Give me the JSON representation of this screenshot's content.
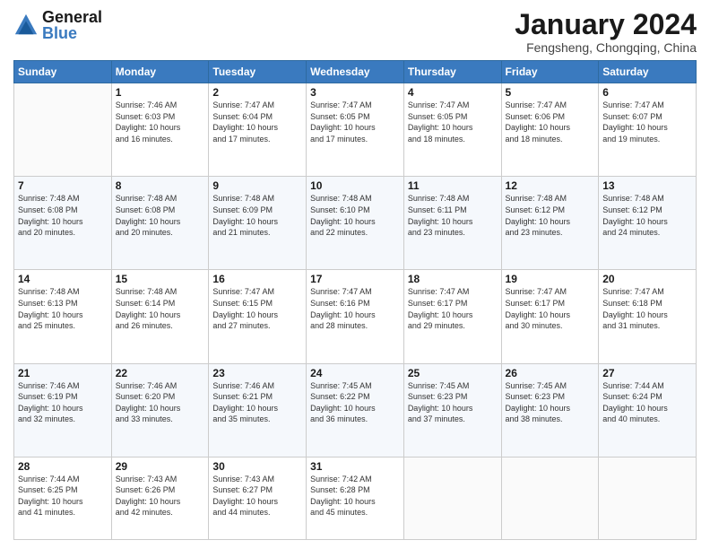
{
  "header": {
    "logo_line1": "General",
    "logo_line2": "Blue",
    "month_year": "January 2024",
    "location": "Fengsheng, Chongqing, China"
  },
  "days_of_week": [
    "Sunday",
    "Monday",
    "Tuesday",
    "Wednesday",
    "Thursday",
    "Friday",
    "Saturday"
  ],
  "weeks": [
    [
      {
        "day": "",
        "info": ""
      },
      {
        "day": "1",
        "info": "Sunrise: 7:46 AM\nSunset: 6:03 PM\nDaylight: 10 hours\nand 16 minutes."
      },
      {
        "day": "2",
        "info": "Sunrise: 7:47 AM\nSunset: 6:04 PM\nDaylight: 10 hours\nand 17 minutes."
      },
      {
        "day": "3",
        "info": "Sunrise: 7:47 AM\nSunset: 6:05 PM\nDaylight: 10 hours\nand 17 minutes."
      },
      {
        "day": "4",
        "info": "Sunrise: 7:47 AM\nSunset: 6:05 PM\nDaylight: 10 hours\nand 18 minutes."
      },
      {
        "day": "5",
        "info": "Sunrise: 7:47 AM\nSunset: 6:06 PM\nDaylight: 10 hours\nand 18 minutes."
      },
      {
        "day": "6",
        "info": "Sunrise: 7:47 AM\nSunset: 6:07 PM\nDaylight: 10 hours\nand 19 minutes."
      }
    ],
    [
      {
        "day": "7",
        "info": "Sunrise: 7:48 AM\nSunset: 6:08 PM\nDaylight: 10 hours\nand 20 minutes."
      },
      {
        "day": "8",
        "info": "Sunrise: 7:48 AM\nSunset: 6:08 PM\nDaylight: 10 hours\nand 20 minutes."
      },
      {
        "day": "9",
        "info": "Sunrise: 7:48 AM\nSunset: 6:09 PM\nDaylight: 10 hours\nand 21 minutes."
      },
      {
        "day": "10",
        "info": "Sunrise: 7:48 AM\nSunset: 6:10 PM\nDaylight: 10 hours\nand 22 minutes."
      },
      {
        "day": "11",
        "info": "Sunrise: 7:48 AM\nSunset: 6:11 PM\nDaylight: 10 hours\nand 23 minutes."
      },
      {
        "day": "12",
        "info": "Sunrise: 7:48 AM\nSunset: 6:12 PM\nDaylight: 10 hours\nand 23 minutes."
      },
      {
        "day": "13",
        "info": "Sunrise: 7:48 AM\nSunset: 6:12 PM\nDaylight: 10 hours\nand 24 minutes."
      }
    ],
    [
      {
        "day": "14",
        "info": "Sunrise: 7:48 AM\nSunset: 6:13 PM\nDaylight: 10 hours\nand 25 minutes."
      },
      {
        "day": "15",
        "info": "Sunrise: 7:48 AM\nSunset: 6:14 PM\nDaylight: 10 hours\nand 26 minutes."
      },
      {
        "day": "16",
        "info": "Sunrise: 7:47 AM\nSunset: 6:15 PM\nDaylight: 10 hours\nand 27 minutes."
      },
      {
        "day": "17",
        "info": "Sunrise: 7:47 AM\nSunset: 6:16 PM\nDaylight: 10 hours\nand 28 minutes."
      },
      {
        "day": "18",
        "info": "Sunrise: 7:47 AM\nSunset: 6:17 PM\nDaylight: 10 hours\nand 29 minutes."
      },
      {
        "day": "19",
        "info": "Sunrise: 7:47 AM\nSunset: 6:17 PM\nDaylight: 10 hours\nand 30 minutes."
      },
      {
        "day": "20",
        "info": "Sunrise: 7:47 AM\nSunset: 6:18 PM\nDaylight: 10 hours\nand 31 minutes."
      }
    ],
    [
      {
        "day": "21",
        "info": "Sunrise: 7:46 AM\nSunset: 6:19 PM\nDaylight: 10 hours\nand 32 minutes."
      },
      {
        "day": "22",
        "info": "Sunrise: 7:46 AM\nSunset: 6:20 PM\nDaylight: 10 hours\nand 33 minutes."
      },
      {
        "day": "23",
        "info": "Sunrise: 7:46 AM\nSunset: 6:21 PM\nDaylight: 10 hours\nand 35 minutes."
      },
      {
        "day": "24",
        "info": "Sunrise: 7:45 AM\nSunset: 6:22 PM\nDaylight: 10 hours\nand 36 minutes."
      },
      {
        "day": "25",
        "info": "Sunrise: 7:45 AM\nSunset: 6:23 PM\nDaylight: 10 hours\nand 37 minutes."
      },
      {
        "day": "26",
        "info": "Sunrise: 7:45 AM\nSunset: 6:23 PM\nDaylight: 10 hours\nand 38 minutes."
      },
      {
        "day": "27",
        "info": "Sunrise: 7:44 AM\nSunset: 6:24 PM\nDaylight: 10 hours\nand 40 minutes."
      }
    ],
    [
      {
        "day": "28",
        "info": "Sunrise: 7:44 AM\nSunset: 6:25 PM\nDaylight: 10 hours\nand 41 minutes."
      },
      {
        "day": "29",
        "info": "Sunrise: 7:43 AM\nSunset: 6:26 PM\nDaylight: 10 hours\nand 42 minutes."
      },
      {
        "day": "30",
        "info": "Sunrise: 7:43 AM\nSunset: 6:27 PM\nDaylight: 10 hours\nand 44 minutes."
      },
      {
        "day": "31",
        "info": "Sunrise: 7:42 AM\nSunset: 6:28 PM\nDaylight: 10 hours\nand 45 minutes."
      },
      {
        "day": "",
        "info": ""
      },
      {
        "day": "",
        "info": ""
      },
      {
        "day": "",
        "info": ""
      }
    ]
  ]
}
